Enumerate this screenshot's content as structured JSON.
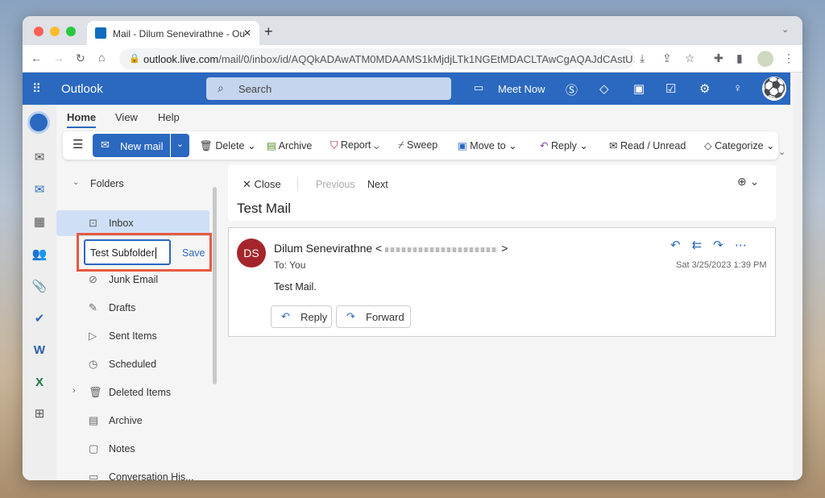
{
  "browser": {
    "tab_title": "Mail - Dilum Senevirathne - Ou",
    "url_host": "outlook.live.com",
    "url_path": "/mail/0/inbox/id/AQQkADAwATM0MDAAMS1kMjdjLTk1NGEtMDACLTAwCgAQAJdCAstU..."
  },
  "header": {
    "app": "Outlook",
    "search_placeholder": "Search",
    "meet_now": "Meet Now"
  },
  "ribbon": {
    "tabs": [
      "Home",
      "View",
      "Help"
    ],
    "new_mail": "New mail",
    "delete": "Delete",
    "archive": "Archive",
    "report": "Report",
    "sweep": "Sweep",
    "move_to": "Move to",
    "reply": "Reply",
    "read_unread": "Read / Unread",
    "categorize": "Categorize"
  },
  "folders": {
    "header": "Folders",
    "inbox": "Inbox",
    "new_folder_value": "Test Subfolder",
    "save": "Save",
    "items": [
      "Junk Email",
      "Drafts",
      "Sent Items",
      "Scheduled",
      "Deleted Items",
      "Archive",
      "Notes",
      "Conversation His..."
    ]
  },
  "reading": {
    "close": "Close",
    "previous": "Previous",
    "next": "Next",
    "subject": "Test Mail"
  },
  "message": {
    "initials": "DS",
    "sender": "Dilum Senevirathne <",
    "sender_end": ">",
    "to_label": "To:",
    "to": "You",
    "date": "Sat 3/25/2023 1:39 PM",
    "body": "Test Mail.",
    "reply": "Reply",
    "forward": "Forward"
  },
  "colors": {
    "brand": "#2b68bf",
    "avatar": "#a4262c",
    "highlight": "#e8593f"
  }
}
